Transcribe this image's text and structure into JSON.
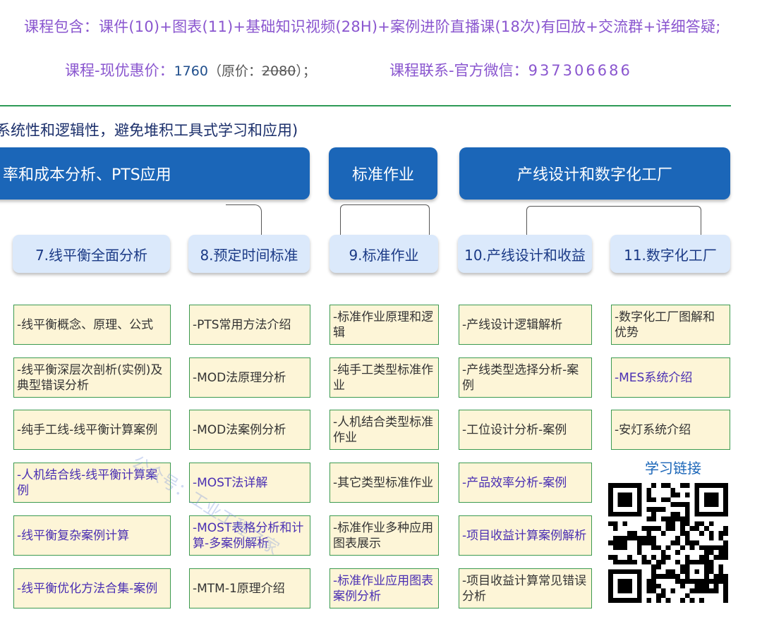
{
  "header": {
    "course_contents": "课程包含：课件(10)+图表(11)+基础知识视频(28H)+案例进阶直播课(18次)有回放+交流群+详细答疑;",
    "price_label": "课程-现优惠价：",
    "price_value": "1760",
    "original_open": "（原价：",
    "original_value": "2080",
    "original_close": "）；",
    "contact_label": "课程联系-官方微信：",
    "contact_value": "937306686"
  },
  "subtitle": "系统性和逻辑性，避免堆积工具式学习和应用)",
  "categories": [
    {
      "label": "率和成本分析、PTS应用"
    },
    {
      "label": "标准作业"
    },
    {
      "label": "产线设计和数字化工厂"
    }
  ],
  "modules": [
    {
      "title": "7.线平衡全面分析",
      "items": [
        {
          "text": "-线平衡概念、原理、公式",
          "style": "normal"
        },
        {
          "text": "-线平衡深层次剖析(实例)及典型错误分析",
          "style": "normal"
        },
        {
          "text": "-纯手工线-线平衡计算案例",
          "style": "normal"
        },
        {
          "text": "-人机结合线-线平衡计算案例",
          "style": "purple"
        },
        {
          "text": "-线平衡复杂案例计算",
          "style": "purple"
        },
        {
          "text": "-线平衡优化方法合集-案例",
          "style": "purple"
        }
      ]
    },
    {
      "title": "8.预定时间标准",
      "items": [
        {
          "text": "-PTS常用方法介绍",
          "style": "normal"
        },
        {
          "text": "-MOD法原理分析",
          "style": "normal"
        },
        {
          "text": "-MOD法案例分析",
          "style": "normal"
        },
        {
          "text": "-MOST法详解",
          "style": "purple"
        },
        {
          "text": "-MOST表格分析和计算-多案例解析",
          "style": "purple"
        },
        {
          "text": "-MTM-1原理介绍",
          "style": "normal"
        }
      ]
    },
    {
      "title": "9.标准作业",
      "items": [
        {
          "text": "-标准作业原理和逻辑",
          "style": "normal"
        },
        {
          "text": "-纯手工类型标准作业",
          "style": "normal"
        },
        {
          "text": "-人机结合类型标准作业",
          "style": "normal"
        },
        {
          "text": "-其它类型标准作业",
          "style": "normal"
        },
        {
          "text": "-标准作业多种应用图表展示",
          "style": "normal"
        },
        {
          "text": "-标准作业应用图表案例分析",
          "style": "purple"
        }
      ]
    },
    {
      "title": "10.产线设计和收益",
      "items": [
        {
          "text": "-产线设计逻辑解析",
          "style": "normal"
        },
        {
          "text": "-产线类型选择分析-案例",
          "style": "normal"
        },
        {
          "text": "-工位设计分析-案例",
          "style": "normal"
        },
        {
          "text": "-产品效率分析-案例",
          "style": "purple"
        },
        {
          "text": "-项目收益计算案例解析",
          "style": "purple"
        },
        {
          "text": "-项目收益计算常见错误分析",
          "style": "normal"
        }
      ]
    },
    {
      "title": "11.数字化工厂",
      "items": [
        {
          "text": "-数字化工厂图解和优势",
          "style": "normal"
        },
        {
          "text": "-MES系统介绍",
          "style": "purple"
        },
        {
          "text": "-安灯系统介绍",
          "style": "normal"
        }
      ]
    }
  ],
  "qr": {
    "title": "学习链接",
    "icon": "qr-code-icon"
  },
  "watermark": "公众号：工业工程之家",
  "colors": {
    "header_purple": "#8a56cf",
    "category_blue": "#1b66b8",
    "module_bg": "#dbe9fb",
    "item_bg": "#fdf5d7",
    "item_border": "#3c9a50",
    "rule_green": "#2e9a57"
  }
}
